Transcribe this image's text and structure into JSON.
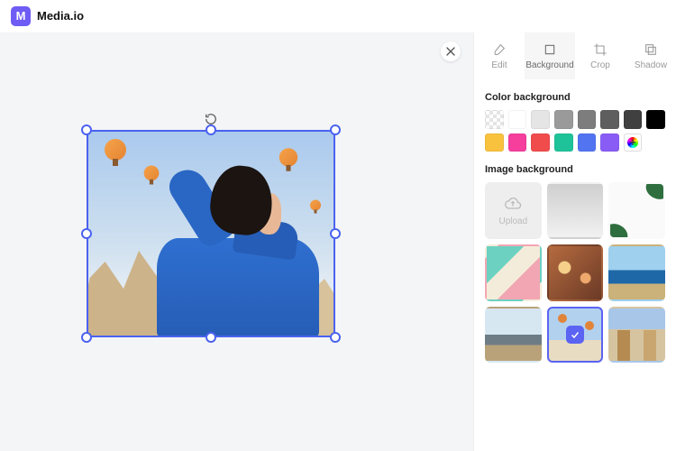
{
  "brand": {
    "mark": "M",
    "name": "Media.io"
  },
  "tabs": [
    {
      "id": "edit",
      "label": "Edit",
      "icon": "brush-icon"
    },
    {
      "id": "background",
      "label": "Background",
      "icon": "square-icon",
      "active": true
    },
    {
      "id": "crop",
      "label": "Crop",
      "icon": "crop-icon"
    },
    {
      "id": "shadow",
      "label": "Shadow",
      "icon": "shadow-icon"
    }
  ],
  "sections": {
    "color_bg_title": "Color background",
    "image_bg_title": "Image background",
    "upload_label": "Upload"
  },
  "color_swatches": [
    [
      "transparent",
      "#ffffff",
      "#e5e5e5",
      "#9a9a9a",
      "#7d7d7d",
      "#5e5e5e",
      "#404040",
      "#000000"
    ],
    [
      "#f9c23e",
      "#f63e9d",
      "#f14c4c",
      "#1fc39a",
      "#5274f1",
      "#8a5cf6",
      "add-color"
    ]
  ],
  "image_backgrounds": [
    {
      "id": "upload",
      "kind": "upload"
    },
    {
      "id": "gray-gradient"
    },
    {
      "id": "leaves"
    },
    {
      "id": "pastel-stripes"
    },
    {
      "id": "bokeh"
    },
    {
      "id": "seashore"
    },
    {
      "id": "mountains"
    },
    {
      "id": "balloons",
      "selected": true
    },
    {
      "id": "street"
    }
  ]
}
